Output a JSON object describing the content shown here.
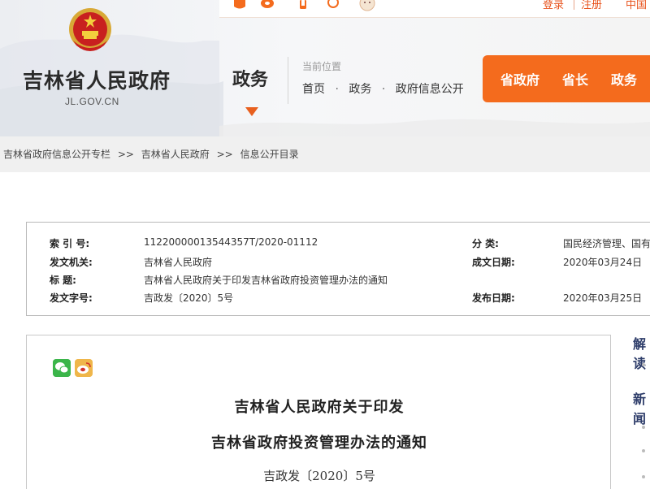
{
  "header": {
    "site_name": "吉林省人民政府",
    "site_domain": "JL.GOV.CN",
    "section_title": "政务",
    "location_label": "当前位置",
    "location_links": [
      "首页",
      "政务",
      "政府信息公开"
    ],
    "location_separator": "·",
    "nav_items": [
      "省政府",
      "省长",
      "政务"
    ],
    "top_links": {
      "login": "登录",
      "register": "注册",
      "lang": "中国"
    },
    "top_icons": [
      "toutiao-icon",
      "weibo-icon",
      "mobile-icon",
      "wechat-icon",
      "mascot-icon"
    ],
    "accent_color": "#f46b1d"
  },
  "breadcrumb": {
    "items": [
      "吉林省政府信息公开专栏",
      "吉林省人民政府",
      "信息公开目录"
    ],
    "separator": ">>"
  },
  "meta": {
    "index_no": {
      "label": "索  引  号:",
      "value": "11220000013544357T/2020-01112"
    },
    "category": {
      "label": "分      类:",
      "value": "国民经济管理、国有"
    },
    "issuer": {
      "label": "发文机关:",
      "value": "吉林省人民政府"
    },
    "written_date": {
      "label": "成文日期:",
      "value": "2020年03月24日"
    },
    "title": {
      "label": "标      题:",
      "value": "吉林省人民政府关于印发吉林省政府投资管理办法的通知"
    },
    "doc_no": {
      "label": "发文字号:",
      "value": "吉政发〔2020〕5号"
    },
    "publish_date": {
      "label": "发布日期:",
      "value": "2020年03月25日"
    }
  },
  "document": {
    "title_line1": "吉林省人民政府关于印发",
    "title_line2": "吉林省政府投资管理办法的通知",
    "doc_number": "吉政发〔2020〕5号",
    "share_icons": [
      "wechat-share-icon",
      "weibo-share-icon"
    ]
  },
  "sidebar": {
    "heading1": "解读",
    "heading2": "新闻"
  }
}
